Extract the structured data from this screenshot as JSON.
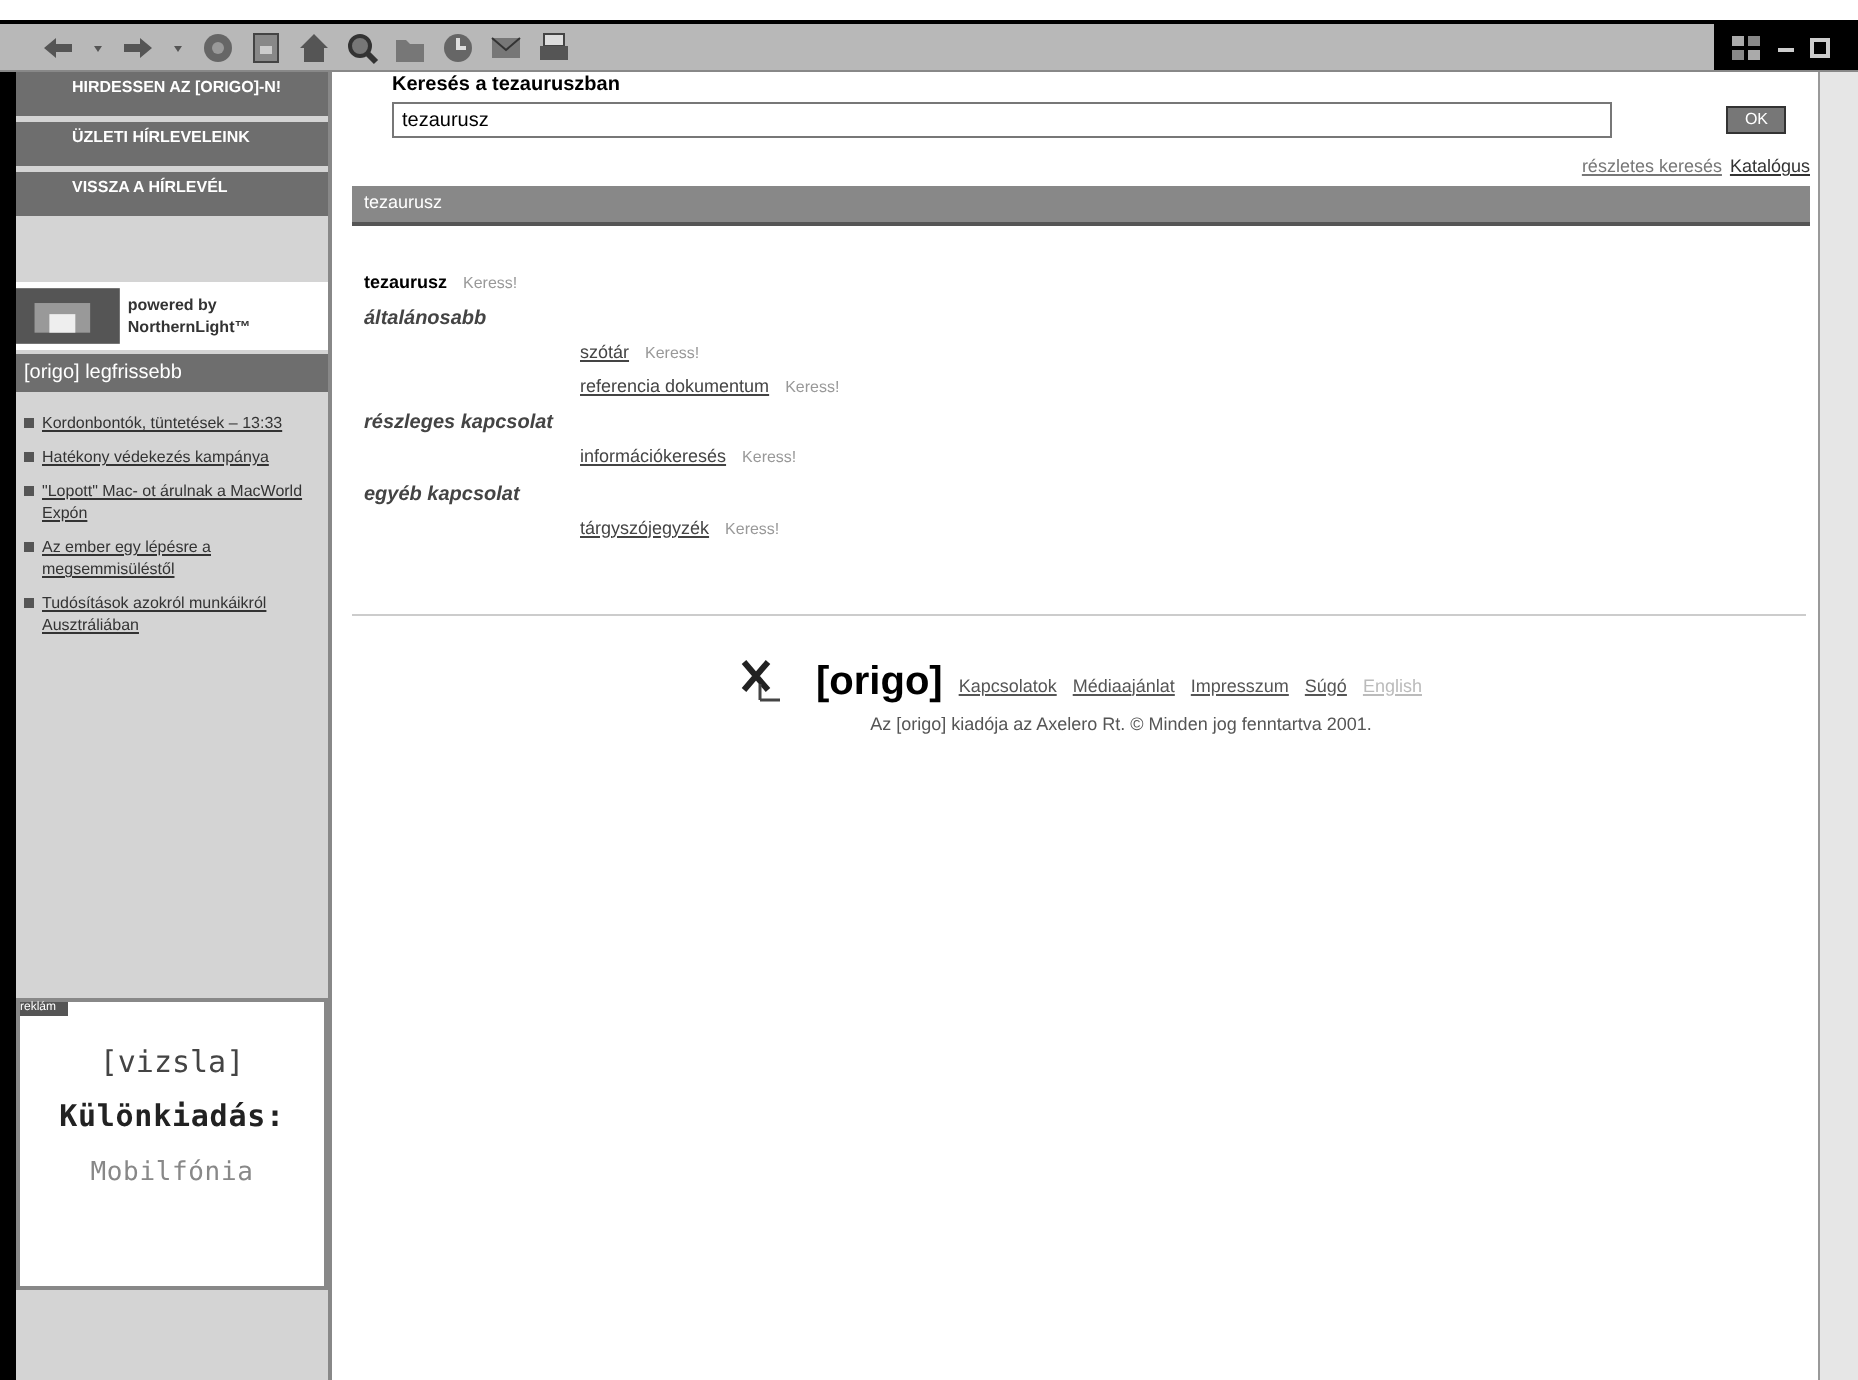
{
  "sidebar": {
    "menu": [
      "HIRDESSEN AZ [ORIGO]-N!",
      "ÜZLETI HÍRLEVELEINK",
      "VISSZA A HÍRLEVÉL"
    ],
    "powered_by": [
      "powered by",
      "NorthernLight™"
    ],
    "news_title": "[origo] legfrissebb",
    "news": [
      "Kordonbontók, tüntetések – 13:33",
      "Hatékony védekezés kampánya",
      "\"Lopott\" Mac- ot árulnak a MacWorld Expón",
      "Az ember egy lépésre a megsemmisüléstől",
      "Tudósítások azokról munkáikról Ausztráliában"
    ],
    "ad": {
      "label": "reklám",
      "lines": [
        "[vizsla]",
        "Különkiadás:",
        "Mobilfónia"
      ]
    }
  },
  "search": {
    "title": "Keresés a tezauruszban",
    "value": "tezaurusz",
    "button": "OK",
    "links": [
      "részletes keresés",
      "Katalógus"
    ]
  },
  "section_title": "tezaurusz",
  "term": {
    "label": "tezaurusz",
    "action": "Keress!"
  },
  "groups": [
    {
      "title": "általánosabb",
      "items": [
        {
          "label": "szótár",
          "action": "Keress!"
        },
        {
          "label": "referencia dokumentum",
          "action": "Keress!"
        }
      ]
    },
    {
      "title": "részleges kapcsolat",
      "items": [
        {
          "label": "információkeresés",
          "action": "Keress!"
        }
      ]
    },
    {
      "title": "egyéb kapcsolat",
      "items": [
        {
          "label": "tárgyszójegyzék",
          "action": "Keress!"
        }
      ]
    }
  ],
  "footer": {
    "logo": "[origo]",
    "links": [
      {
        "label": "Kapcsolatok",
        "disabled": false
      },
      {
        "label": "Médiaajánlat",
        "disabled": false
      },
      {
        "label": "Impresszum",
        "disabled": false
      },
      {
        "label": "Súgó",
        "disabled": false
      },
      {
        "label": "English",
        "disabled": true
      }
    ],
    "copyright": "Az [origo] kiadója az Axelero Rt. © Minden jog fenntartva 2001."
  }
}
